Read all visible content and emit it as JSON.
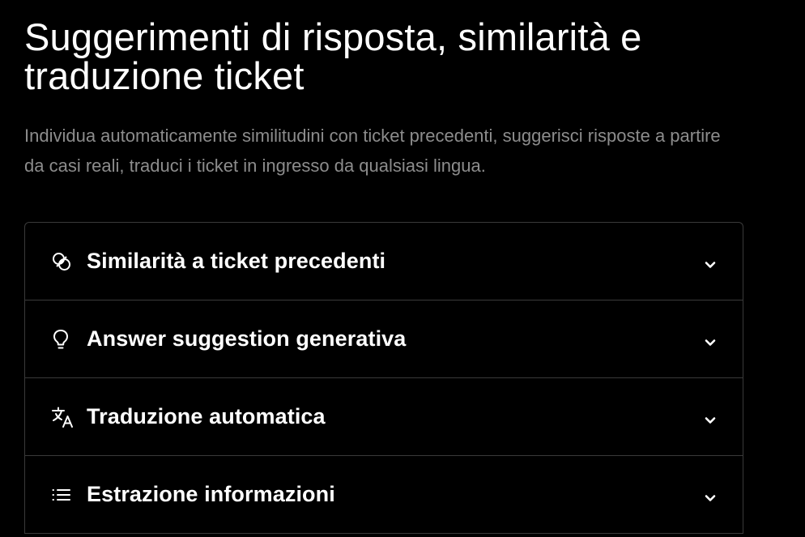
{
  "header": {
    "title": "Suggerimenti di risposta, similarità e traduzione ticket",
    "subtitle": "Individua automaticamente similitudini con ticket precedenti, suggerisci risposte a partire da casi reali, traduci i ticket in ingresso da qualsiasi lingua."
  },
  "accordion": {
    "items": [
      {
        "label": "Similarità a ticket precedenti",
        "icon": "link-circles-icon"
      },
      {
        "label": "Answer suggestion generativa",
        "icon": "lightbulb-icon"
      },
      {
        "label": "Traduzione automatica",
        "icon": "translate-icon"
      },
      {
        "label": "Estrazione informazioni",
        "icon": "list-icon"
      }
    ],
    "expand_icon": "chevron-down-icon"
  },
  "colors": {
    "background": "#000000",
    "title": "#ffffff",
    "subtitle": "#8c8c8c",
    "border": "#3a3a3a"
  }
}
